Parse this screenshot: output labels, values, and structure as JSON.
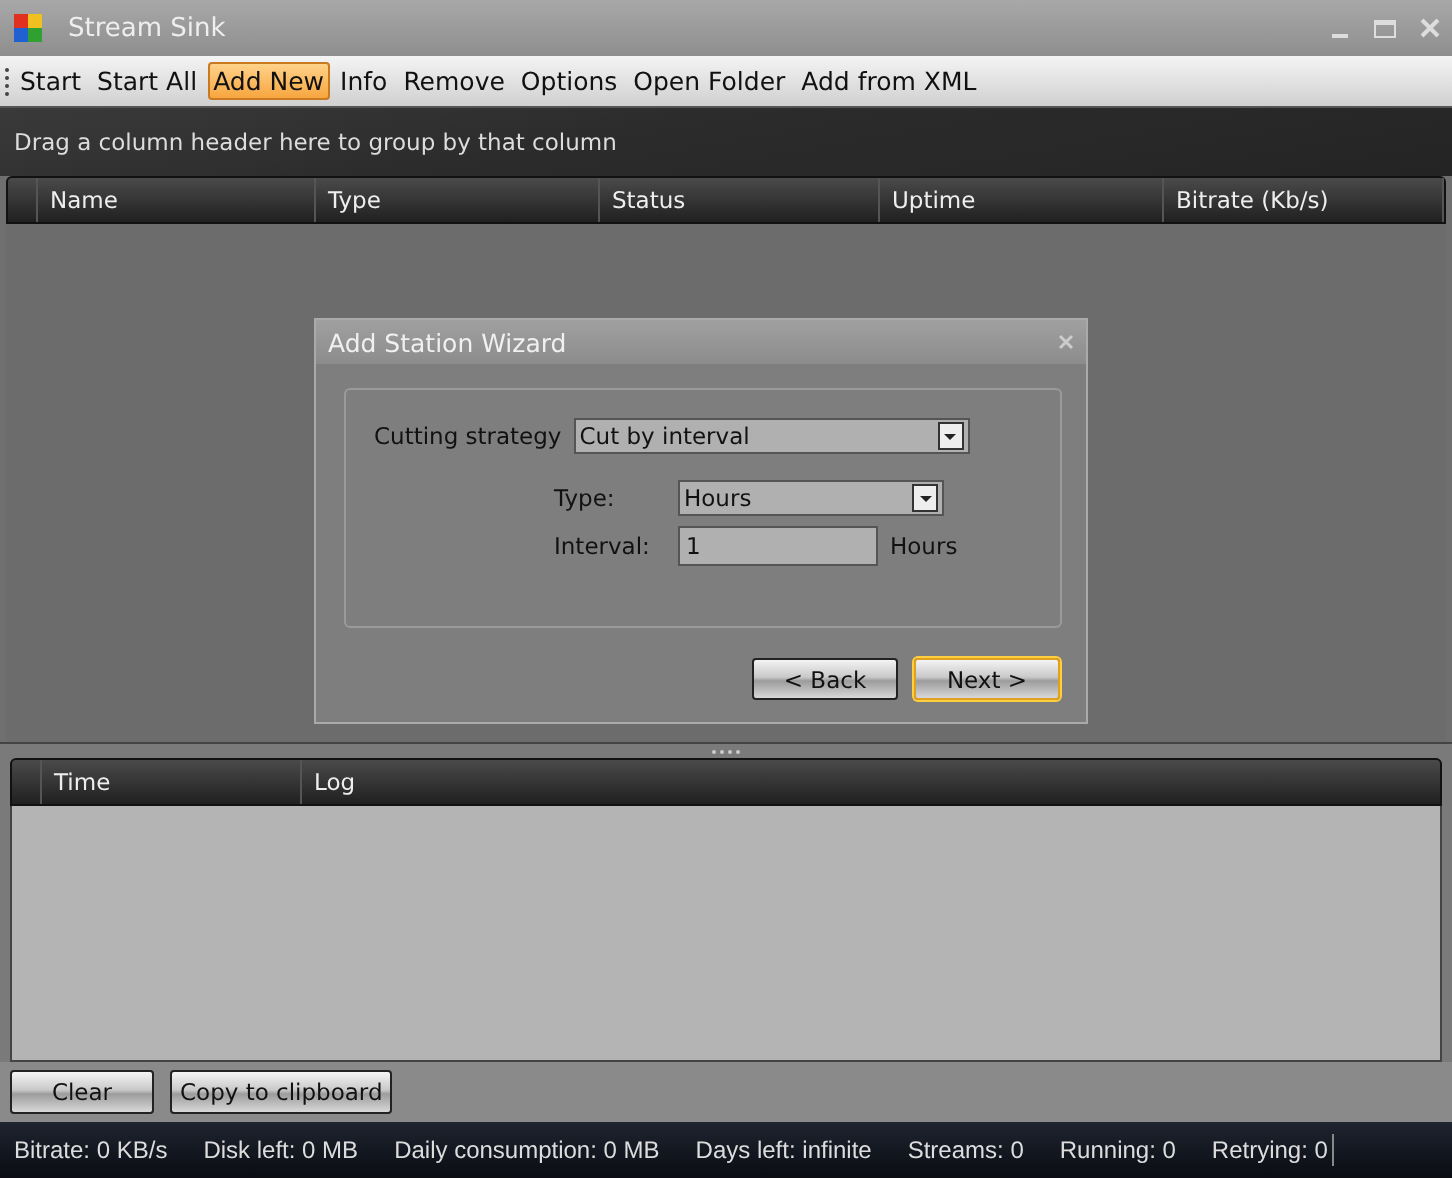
{
  "window": {
    "title": "Stream Sink"
  },
  "toolbar": [
    {
      "label": "Start",
      "selected": false
    },
    {
      "label": "Start All",
      "selected": false
    },
    {
      "label": "Add New",
      "selected": true
    },
    {
      "label": "Info",
      "selected": false
    },
    {
      "label": "Remove",
      "selected": false
    },
    {
      "label": "Options",
      "selected": false
    },
    {
      "label": "Open Folder",
      "selected": false
    },
    {
      "label": "Add from XML",
      "selected": false
    }
  ],
  "stations_grid": {
    "group_hint": "Drag a column header here to group by that column",
    "columns": [
      "Name",
      "Type",
      "Status",
      "Uptime",
      "Bitrate (Kb/s)"
    ]
  },
  "dialog": {
    "title": "Add Station Wizard",
    "cutting_strategy": {
      "label": "Cutting strategy",
      "value": "Cut by interval"
    },
    "type": {
      "label": "Type:",
      "value": "Hours"
    },
    "interval": {
      "label": "Interval:",
      "value": "1",
      "unit": "Hours"
    },
    "buttons": [
      {
        "label": "< Back",
        "selected": false
      },
      {
        "label": "Next >",
        "selected": true
      }
    ]
  },
  "log_grid": {
    "columns": [
      "Time",
      "Log"
    ]
  },
  "log_buttons": [
    "Clear",
    "Copy to clipboard"
  ],
  "status_bar": [
    "Bitrate: 0 KB/s",
    "Disk left: 0 MB",
    "Daily consumption: 0 MB",
    "Days left: infinite",
    "Streams: 0",
    "Running: 0",
    "Retrying: 0"
  ]
}
